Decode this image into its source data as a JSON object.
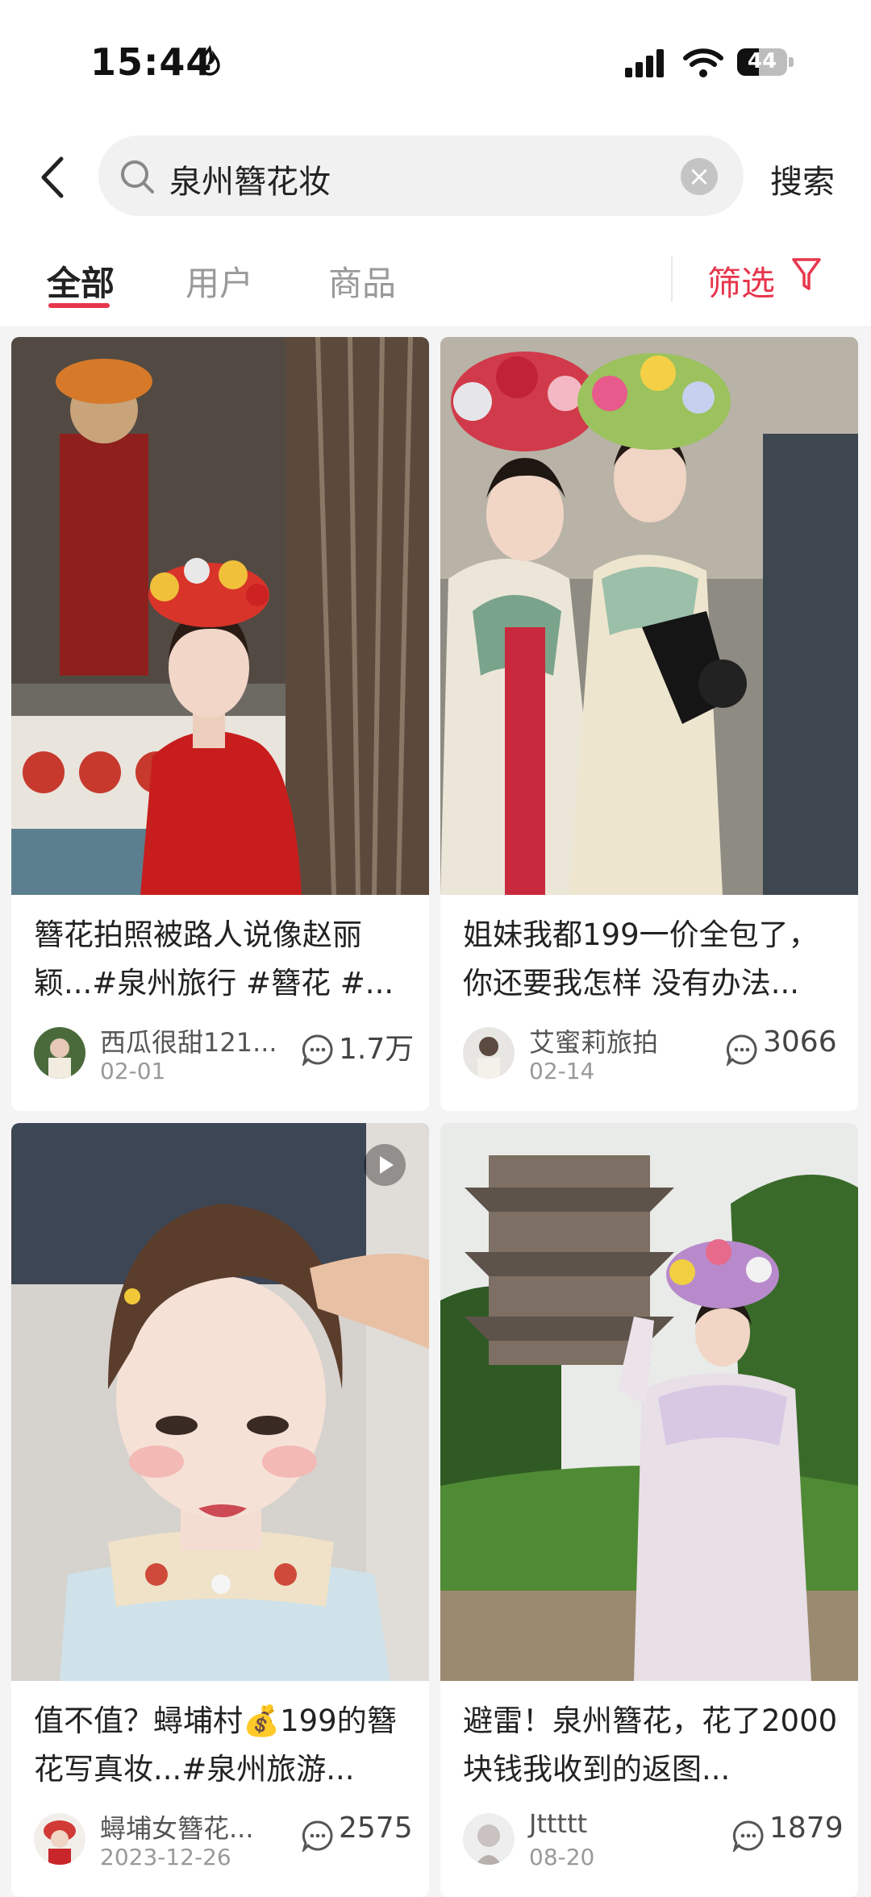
{
  "status_bar": {
    "time": "15:44",
    "battery": "44",
    "battery_level": 0.44
  },
  "search": {
    "query": "泉州簪花妆",
    "button": "搜索"
  },
  "tabs": [
    {
      "label": "全部",
      "active": true
    },
    {
      "label": "用户",
      "active": false
    },
    {
      "label": "商品",
      "active": false
    }
  ],
  "filter": {
    "label": "筛选"
  },
  "colors": {
    "accent": "#e8364c"
  },
  "cards": [
    {
      "title": "簪花拍照被路人说像赵丽颖...#泉州旅行 #簪花 #...",
      "author": "西瓜很甜121...",
      "date": "02-01",
      "comments": "1.7万",
      "video": false
    },
    {
      "title": "姐妹我都199一价全包了，你还要我怎样 没有办法...",
      "author": "艾蜜莉旅拍",
      "date": "02-14",
      "comments": "3066",
      "video": false
    },
    {
      "title": "值不值？蟳埔村💰199的簪花写真妆...#泉州旅游...",
      "author": "蟳埔女簪花...",
      "date": "2023-12-26",
      "comments": "2575",
      "video": true
    },
    {
      "title": "避雷！泉州簪花，花了2000块钱我收到的返图...",
      "author": "Jttttt",
      "date": "08-20",
      "comments": "1879",
      "video": false
    }
  ]
}
